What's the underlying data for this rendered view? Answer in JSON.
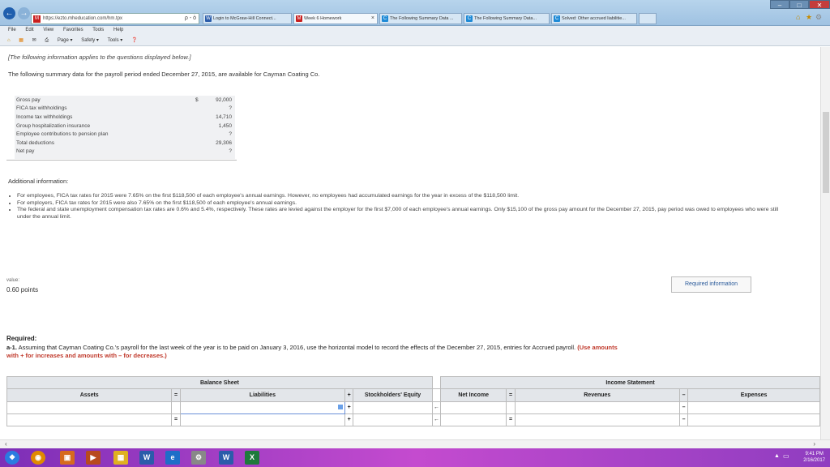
{
  "browser": {
    "address": "https://ezto.mheducation.com/hm.tpx",
    "address_symbols": "ρ - ò",
    "tabs": [
      {
        "label": "Login to McGraw-Hill Connect...",
        "icon": "W",
        "color": "#2b5caa"
      },
      {
        "label": "Week 6 Homework",
        "icon": "M",
        "color": "#c81e1e"
      },
      {
        "label": "The Following Summary Data ...",
        "icon": "C",
        "color": "#1e8ad6"
      },
      {
        "label": "The Following Summary Data...",
        "icon": "C",
        "color": "#1e8ad6"
      },
      {
        "label": "Solved: Other accrued liabilitie...",
        "icon": "C",
        "color": "#1e8ad6"
      }
    ],
    "menu": [
      "File",
      "Edit",
      "View",
      "Favorites",
      "Tools",
      "Help"
    ],
    "commands": [
      "Page ▾",
      "Safety ▾",
      "Tools ▾"
    ],
    "window_controls": [
      "–",
      "□",
      "✕"
    ]
  },
  "page": {
    "intro_note": "[The following information applies to the questions displayed below.]",
    "intro": "The following summary data for the payroll period ended December 27, 2015, are available for Cayman Coating Co.",
    "summary": [
      {
        "label": "Gross pay",
        "currency": "$",
        "value": "92,000"
      },
      {
        "label": "FICA tax withholdings",
        "currency": "",
        "value": "?"
      },
      {
        "label": "Income tax withholdings",
        "currency": "",
        "value": "14,710"
      },
      {
        "label": "Group hospitalization insurance",
        "currency": "",
        "value": "1,450"
      },
      {
        "label": "Employee contributions to pension plan",
        "currency": "",
        "value": "?"
      },
      {
        "label": "Total deductions",
        "currency": "",
        "value": "29,306"
      },
      {
        "label": "Net pay",
        "currency": "",
        "value": "?"
      }
    ],
    "additional_heading": "Additional information:",
    "bullets": [
      "For employees, FICA tax rates for 2015 were 7.65% on the first $118,500 of each employee's annual earnings. However, no employees had accumulated earnings for the year in excess of the $118,500 limit.",
      "For employers, FICA tax rates for 2015 were also 7.65% on the first $118,500 of each employee's annual earnings.",
      "The federal and state unemployment compensation tax rates are 0.6% and 5.4%, respectively. These rates are levied against the employer for the first $7,000 of each employee's annual earnings. Only $15,100 of the gross pay amount for the December 27, 2015, pay period was owed to employees who were still under the annual limit."
    ],
    "value_label": "value:",
    "points": "0.60 points",
    "required_info_button": "Required information",
    "required_heading": "Required:",
    "question_prefix": "a-1.",
    "question": " Assuming that Cayman Coating Co.'s payroll for the last week of the year is to be paid on January 3, 2016, use the horizontal model to record the effects of the December 27, 2015, entries for Accrued payroll.",
    "question_emphasis": "(Use amounts",
    "question_emphasis2": "with + for increases and amounts with – for decreases.)"
  },
  "model": {
    "group_balance": "Balance Sheet",
    "group_income": "Income Statement",
    "headers": {
      "assets": "Assets",
      "eq": "=",
      "liabilities": "Liabilities",
      "plus": "+",
      "equity": "Stockholders' Equity",
      "net_income": "Net Income",
      "eq2": "=",
      "revenues": "Revenues",
      "minus": "–",
      "expenses": "Expenses"
    },
    "row_ops": {
      "r1_eq": "",
      "r1_plus": "+",
      "r1_arrow": "←",
      "r1_eq2": "",
      "r1_minus": "–",
      "r2_eq": "=",
      "r2_plus": "+",
      "r2_arrow": "←",
      "r2_eq2": "=",
      "r2_minus": "–"
    }
  },
  "taskbar": {
    "time": "9:41 PM",
    "date": "2/16/2017"
  }
}
